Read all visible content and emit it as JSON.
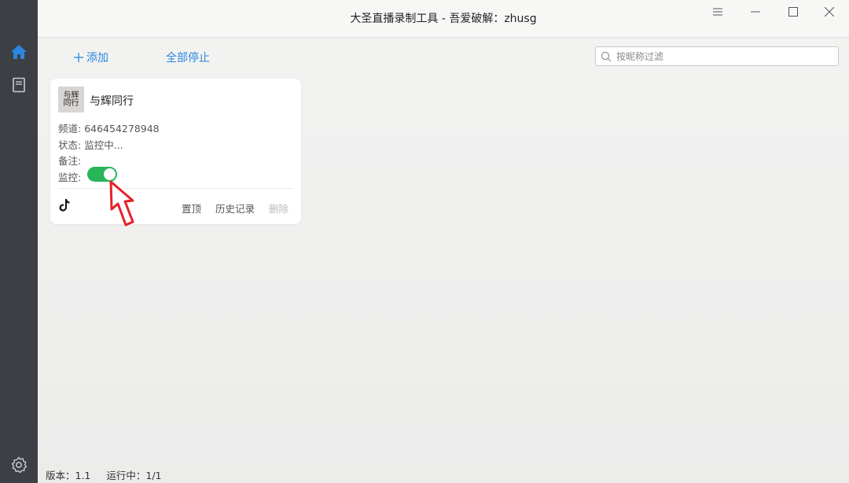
{
  "window": {
    "title": "大圣直播录制工具 - 吾爱破解：zhusg",
    "controls": [
      "menu-icon",
      "minimize-icon",
      "maximize-icon",
      "close-icon"
    ]
  },
  "sidebar": {
    "items": [
      {
        "name": "home",
        "icon": "home-icon",
        "active": true
      },
      {
        "name": "records",
        "icon": "book-icon",
        "active": false
      }
    ],
    "bottom": {
      "icon": "gear-icon"
    }
  },
  "toolbar": {
    "add_label": "添加",
    "stop_all_label": "全部停止",
    "search_placeholder": "按昵称过滤"
  },
  "cards": [
    {
      "name": "与辉同行",
      "avatar_text": "与辉\n同行",
      "channel_label": "频道:",
      "channel_value": "646454278948",
      "status_label": "状态:",
      "status_value": "监控中...",
      "note_label": "备注:",
      "note_value": "",
      "monitor_label": "监控:",
      "monitor_on": true,
      "platform_icon": "tiktok-icon",
      "actions": {
        "pin": "置顶",
        "history": "历史记录",
        "delete": "删除"
      }
    }
  ],
  "statusbar": {
    "version": "版本：1.1",
    "running": "运行中：1/1"
  },
  "colors": {
    "accent": "#2a86e0",
    "toggle_on": "#27b55a",
    "sidebar_bg": "#3c3f43",
    "annotation_arrow": "#e8202a"
  }
}
